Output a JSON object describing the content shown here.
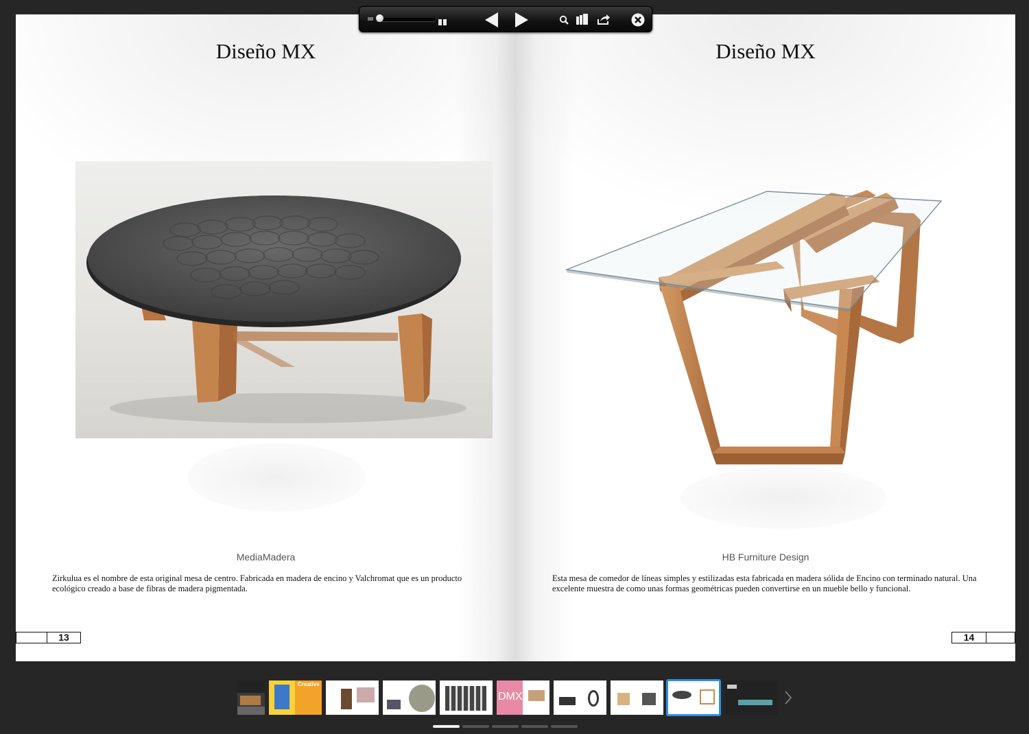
{
  "toolbar": {
    "zoom_label": "Zoom",
    "icons": [
      "zoom-out-icon",
      "grid-icon",
      "prev-arrow-icon",
      "next-arrow-icon",
      "search-icon",
      "library-icon",
      "share-icon",
      "close-icon"
    ],
    "slider_level": 0.0
  },
  "left_page": {
    "title": "Diseño MX",
    "caption": "MediaMadera",
    "body": "Zirkulua es el nombre de esta original mesa de centro. Fabricada en madera de encino y Valchromat que es un producto ecológico creado a base de fibras de madera pigmentada.",
    "page_number": "13"
  },
  "right_page": {
    "title": "Diseño MX",
    "caption": "HB Furniture Design",
    "body": "Esta mesa de comedor de líneas simples y estilizadas esta fabricada en madera sólida de Encino con terminado natural. Una excelente muestra de como unas formas geométricas pueden convertirse en un mueble bello y funcional.",
    "page_number": "14"
  },
  "thumbnails": {
    "items": [
      {
        "label": ""
      },
      {
        "label": "Creative"
      },
      {
        "label": ""
      },
      {
        "label": ""
      },
      {
        "label": ""
      },
      {
        "label": "DMX"
      },
      {
        "label": ""
      },
      {
        "label": ""
      },
      {
        "label": ""
      },
      {
        "label": ""
      }
    ],
    "selected_index": 8,
    "pager_count": 5,
    "pager_active": 0
  },
  "colors": {
    "background": "#262626",
    "selected_thumb": "#2e8fe6",
    "wood": "#c98a55",
    "tabletop": "#4a4a4a"
  }
}
